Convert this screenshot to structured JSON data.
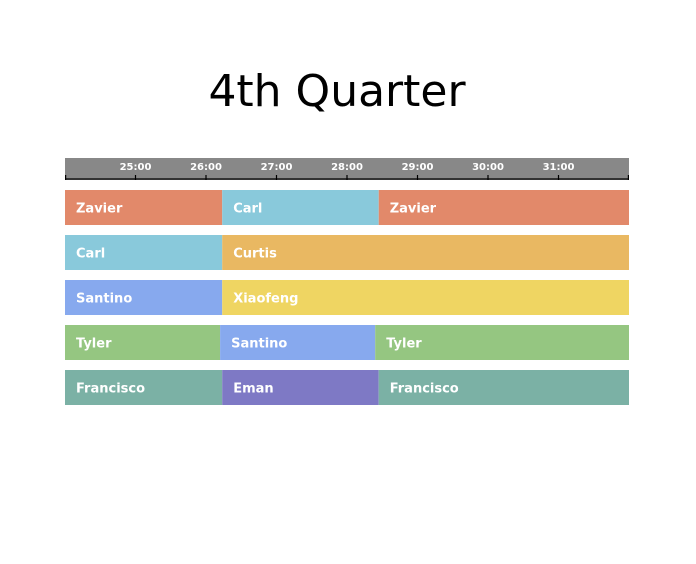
{
  "title": "4th Quarter",
  "chart_data": {
    "type": "gantt",
    "title": "4th Quarter",
    "x_unit": "minutes",
    "x_range": [
      24,
      32
    ],
    "ticks": [
      {
        "value": 25,
        "label": "25:00"
      },
      {
        "value": 26,
        "label": "26:00"
      },
      {
        "value": 27,
        "label": "27:00"
      },
      {
        "value": 28,
        "label": "28:00"
      },
      {
        "value": 29,
        "label": "29:00"
      },
      {
        "value": 30,
        "label": "30:00"
      },
      {
        "value": 31,
        "label": "31:00"
      }
    ],
    "rows": [
      {
        "segments": [
          {
            "player": "Zavier",
            "start": 24,
            "end": 26.23
          },
          {
            "player": "Carl",
            "start": 26.23,
            "end": 28.45
          },
          {
            "player": "Zavier",
            "start": 28.45,
            "end": 32
          }
        ]
      },
      {
        "segments": [
          {
            "player": "Carl",
            "start": 24,
            "end": 26.23
          },
          {
            "player": "Curtis",
            "start": 26.23,
            "end": 32
          }
        ]
      },
      {
        "segments": [
          {
            "player": "Santino",
            "start": 24,
            "end": 26.23
          },
          {
            "player": "Xiaofeng",
            "start": 26.23,
            "end": 32
          }
        ]
      },
      {
        "segments": [
          {
            "player": "Tyler",
            "start": 24,
            "end": 26.2
          },
          {
            "player": "Santino",
            "start": 26.2,
            "end": 28.4
          },
          {
            "player": "Tyler",
            "start": 28.4,
            "end": 32
          }
        ]
      },
      {
        "segments": [
          {
            "player": "Francisco",
            "start": 24,
            "end": 26.23
          },
          {
            "player": "Eman",
            "start": 26.23,
            "end": 28.45
          },
          {
            "player": "Francisco",
            "start": 28.45,
            "end": 32
          }
        ]
      }
    ],
    "colors": {
      "Zavier": "#e2896a",
      "Carl": "#89c9db",
      "Curtis": "#e9b862",
      "Santino": "#87a9ee",
      "Xiaofeng": "#efd562",
      "Tyler": "#95c681",
      "Francisco": "#7bb1a5",
      "Eman": "#7e79c5"
    },
    "axis_color": "#888888"
  }
}
